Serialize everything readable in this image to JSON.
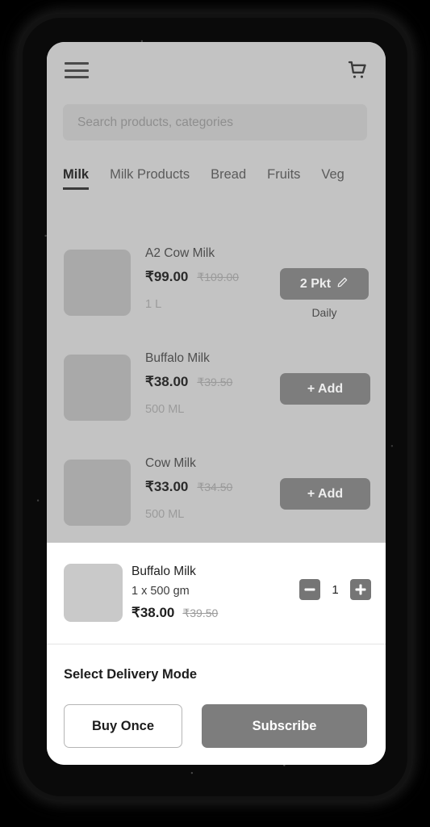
{
  "header": {
    "menu_icon": "hamburger-menu-icon",
    "cart_icon": "shopping-cart-icon"
  },
  "search": {
    "placeholder": "Search products, categories",
    "value": ""
  },
  "tabs": [
    {
      "label": "Milk",
      "active": true
    },
    {
      "label": "Milk Products",
      "active": false
    },
    {
      "label": "Bread",
      "active": false
    },
    {
      "label": "Fruits",
      "active": false
    },
    {
      "label": "Veg",
      "active": false
    }
  ],
  "products": [
    {
      "name": "A2 Cow Milk",
      "price": "₹99.00",
      "strike_price": "₹109.00",
      "size": "1 L",
      "action_label": "2 Pkt",
      "action_icon": "pencil-edit-icon",
      "action_note": "Daily"
    },
    {
      "name": "Buffalo Milk",
      "price": "₹38.00",
      "strike_price": "₹39.50",
      "size": "500 ML",
      "action_label": "+ Add",
      "action_icon": "",
      "action_note": ""
    },
    {
      "name": "Cow Milk",
      "price": "₹33.00",
      "strike_price": "₹34.50",
      "size": "500 ML",
      "action_label": "+ Add",
      "action_icon": "",
      "action_note": ""
    }
  ],
  "sheet": {
    "cart_item": {
      "name": "Buffalo Milk",
      "qty_text": "1 x 500 gm",
      "price": "₹38.00",
      "strike_price": "₹39.50",
      "quantity": "1",
      "decrement_icon": "minus-icon",
      "increment_icon": "plus-icon"
    },
    "delivery_title": "Select Delivery Mode",
    "buy_once_label": "Buy Once",
    "subscribe_label": "Subscribe"
  },
  "colors": {
    "scrim": "#c3c3c3",
    "button_grey": "#7d7d7d",
    "sheet_bg": "#ffffff",
    "text_dark": "#1c1c1c"
  }
}
